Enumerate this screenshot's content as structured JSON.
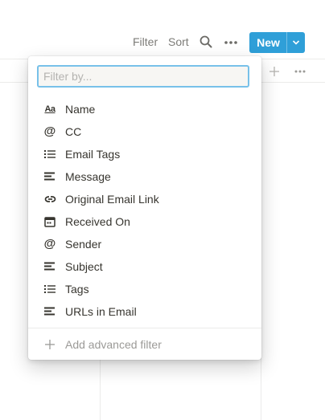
{
  "toolbar": {
    "filter_label": "Filter",
    "sort_label": "Sort",
    "new_label": "New",
    "search_icon": "search-icon",
    "more_icon": "ellipsis-icon",
    "accent_color": "#2f9fd8"
  },
  "filter_menu": {
    "search_placeholder": "Filter by...",
    "search_value": "",
    "properties": [
      {
        "label": "Name",
        "icon": "text-aa-icon"
      },
      {
        "label": "CC",
        "icon": "at-sign-icon"
      },
      {
        "label": "Email Tags",
        "icon": "list-icon"
      },
      {
        "label": "Message",
        "icon": "text-lines-icon"
      },
      {
        "label": "Original Email Link",
        "icon": "link-icon"
      },
      {
        "label": "Received On",
        "icon": "calendar-icon"
      },
      {
        "label": "Sender",
        "icon": "at-sign-icon"
      },
      {
        "label": "Subject",
        "icon": "text-lines-icon"
      },
      {
        "label": "Tags",
        "icon": "list-icon"
      },
      {
        "label": "URLs in Email",
        "icon": "text-lines-icon"
      }
    ],
    "advanced_label": "Add advanced filter"
  }
}
